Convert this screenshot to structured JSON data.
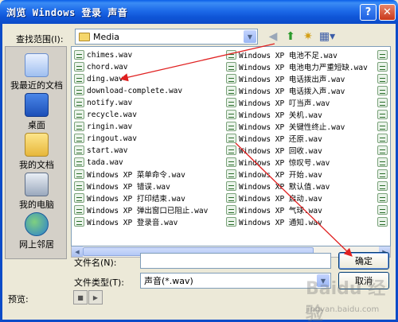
{
  "window": {
    "title": "浏览 Windows 登录 声音"
  },
  "look_in": {
    "label": "查找范围(I):",
    "value": "Media"
  },
  "places": [
    {
      "label": "我最近的文档",
      "icon": "recent-documents-icon"
    },
    {
      "label": "桌面",
      "icon": "desktop-icon"
    },
    {
      "label": "我的文档",
      "icon": "my-documents-icon"
    },
    {
      "label": "我的电脑",
      "icon": "my-computer-icon"
    },
    {
      "label": "网上邻居",
      "icon": "network-places-icon"
    }
  ],
  "files_col1": [
    "chimes.wav",
    "chord.wav",
    "ding.wav",
    "download-complete.wav",
    "notify.wav",
    "recycle.wav",
    "ringin.wav",
    "ringout.wav",
    "start.wav",
    "tada.wav",
    "Windows XP 菜单命令.wav",
    "Windows XP 错误.wav",
    "Windows XP 打印结束.wav",
    "Windows XP 弹出窗口已阻止.wav",
    "Windows XP 登录音.wav"
  ],
  "files_col2": [
    "Windows XP 电池不足.wav",
    "Windows XP 电池电力严重短缺.wav",
    "Windows XP 电话拨出声.wav",
    "Windows XP 电话拨入声.wav",
    "Windows XP 叮当声.wav",
    "Windows XP 关机.wav",
    "Windows XP 关键性终止.wav",
    "Windows XP 还原.wav",
    "Windows XP 回收.wav",
    "Windows XP 惊叹号.wav",
    "Windows XP 开始.wav",
    "Windows XP 默认值.wav",
    "Windows XP 启动.wav",
    "Windows XP 气球.wav",
    "Windows XP 通知.wav"
  ],
  "filename": {
    "label": "文件名(N):",
    "value": ""
  },
  "filetype": {
    "label": "文件类型(T):",
    "value": "声音(*.wav)"
  },
  "buttons": {
    "ok": "确定",
    "cancel": "取消"
  },
  "preview": {
    "label": "预览:"
  },
  "watermark": {
    "main": "Baidu 经验",
    "sub": "jingyan.baidu.com"
  }
}
